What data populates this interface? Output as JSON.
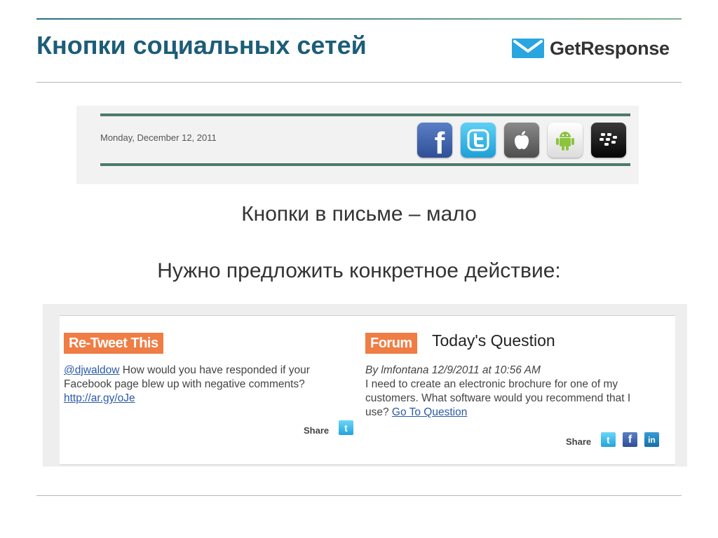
{
  "slide": {
    "title": "Кнопки социальных сетей",
    "logo_text": "GetResponse",
    "caption1": "Кнопки в письме – мало",
    "caption2": "Нужно предложить конкретное действие:"
  },
  "email_header": {
    "date": "Monday, December 12, 2011",
    "icons": [
      "facebook-icon",
      "twitter-icon",
      "apple-icon",
      "android-icon",
      "blackberry-icon"
    ]
  },
  "retweet": {
    "tag": "Re-Tweet This",
    "handle": "@djwaldow",
    "text_line1": " How would you have responded if your",
    "text_line2": "Facebook page blew up with negative comments?",
    "link": "http://ar.gy/oJe",
    "share": "Share"
  },
  "forum": {
    "tag": "Forum",
    "title": "Today's Question",
    "byline": "By lmfontana 12/9/2011 at 10:56 AM",
    "text_line1": "I need to create an electronic brochure for one of my",
    "text_line2": "customers. What software would you recommend that I",
    "text_line3": "use? ",
    "link": "Go To Question",
    "share": "Share"
  },
  "colors": {
    "title": "#1d5d78",
    "accent_orange": "#ef7d45",
    "logo_blue": "#29a6e0",
    "link": "#2a5aa8"
  }
}
